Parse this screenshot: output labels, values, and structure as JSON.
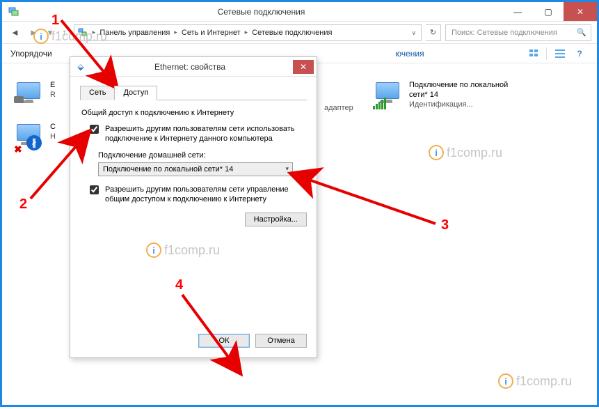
{
  "window": {
    "title": "Сетевые подключения",
    "min": "—",
    "max": "▢",
    "close": "✕"
  },
  "address": {
    "root": "",
    "crumb1": "Панель управления",
    "crumb2": "Сеть и Интернет",
    "crumb3": "Сетевые подключения",
    "search_placeholder": "Поиск: Сетевые подключения"
  },
  "menustrip": {
    "left": "Упорядочи"
  },
  "peek": {
    "title_fragment": "ючения",
    "line2": "адаптер"
  },
  "items": {
    "eth": {
      "line1": "E",
      "line2": "R"
    },
    "bt": {
      "line1": "С",
      "line2": "Н"
    },
    "lan": {
      "line1": "Подключение по локальной",
      "line2": "сети* 14",
      "line3": "Идентификация..."
    }
  },
  "dialog": {
    "title": "Ethernet: свойства",
    "tabs": {
      "net": "Сеть",
      "access": "Доступ"
    },
    "group": "Общий доступ к подключению к Интернету",
    "chk1": "Разрешить другим пользователям сети использовать подключение к Интернету данного компьютера",
    "dd_label": "Подключение домашней сети:",
    "dd_value": "Подключение по локальной сети* 14",
    "chk2": "Разрешить другим пользователям сети управление общим доступом к подключению к Интернету",
    "settings": "Настройка...",
    "ok": "ОК",
    "cancel": "Отмена"
  },
  "annotations": {
    "n1": "1",
    "n2": "2",
    "n3": "3",
    "n4": "4"
  },
  "watermark": "f1comp.ru"
}
